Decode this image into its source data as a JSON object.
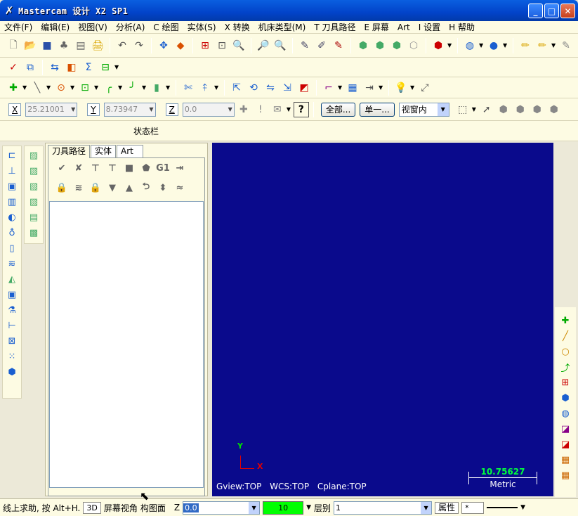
{
  "window": {
    "title": "Mastercam 设计  X2 SP1",
    "minimize": "_",
    "maximize": "□",
    "close": "✕"
  },
  "menu": [
    "文件(F)",
    "编辑(E)",
    "视图(V)",
    "分析(A)",
    "C 绘图",
    "实体(S)",
    "X 转换",
    "机床类型(M)",
    "T 刀具路径",
    "E 屏幕",
    "Art",
    "I 设置",
    "H 帮助"
  ],
  "coords": {
    "x_label": "X",
    "x_value": "25.21001",
    "y_label": "Y",
    "y_value": "8.73947",
    "z_label": "Z",
    "z_value": "0.0",
    "help": "?",
    "all_button": "全部...",
    "single_button": "单一...",
    "select_mode": "视窗内"
  },
  "status_title": "状态栏",
  "panel": {
    "tabs": [
      "刀具路径",
      "实体",
      "Art"
    ],
    "g1": "G1"
  },
  "viewport": {
    "axis_y": "Y",
    "axis_x": "X",
    "gview": "Gview:TOP",
    "wcs": "WCS:TOP",
    "cplane": "Cplane:TOP",
    "scale_value": "10.75627",
    "scale_unit": "Metric",
    "background": "#0a0a8c"
  },
  "bottom": {
    "hint": "线上求助, 按 Alt+H.",
    "mode_3d": "3D",
    "screen_view": "屏幕视角",
    "construct_plane": "构图面",
    "z_label": "Z",
    "z_value": "0.0",
    "color_value": "10",
    "level_label": "层别",
    "level_value": "1",
    "attributes": "属性",
    "point_style": "*"
  }
}
